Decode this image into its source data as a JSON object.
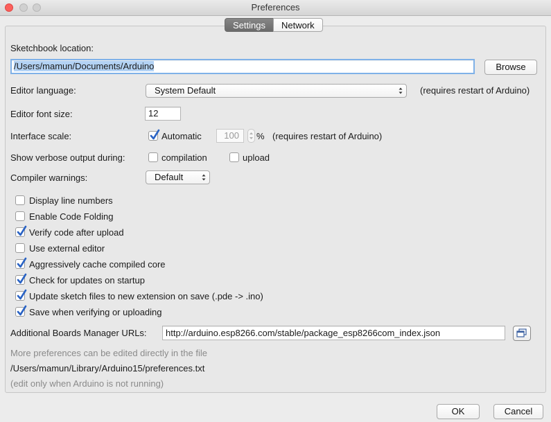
{
  "window": {
    "title": "Preferences"
  },
  "tabs": [
    {
      "label": "Settings",
      "active": true
    },
    {
      "label": "Network",
      "active": false
    }
  ],
  "sketchbook": {
    "label": "Sketchbook location:",
    "value": "/Users/mamun/Documents/Arduino",
    "browse_label": "Browse"
  },
  "editor_language": {
    "label": "Editor language:",
    "value": "System Default",
    "note": "(requires restart of Arduino)"
  },
  "font_size": {
    "label": "Editor font size:",
    "value": "12"
  },
  "interface_scale": {
    "label": "Interface scale:",
    "automatic_label": "Automatic",
    "automatic_checked": true,
    "value": "100",
    "unit": "%",
    "note": "(requires restart of Arduino)"
  },
  "verbose": {
    "label": "Show verbose output during:",
    "compilation_label": "compilation",
    "compilation_checked": false,
    "upload_label": "upload",
    "upload_checked": false
  },
  "compiler_warnings": {
    "label": "Compiler warnings:",
    "value": "Default"
  },
  "options": [
    {
      "label": "Display line numbers",
      "checked": false
    },
    {
      "label": "Enable Code Folding",
      "checked": false
    },
    {
      "label": "Verify code after upload",
      "checked": true
    },
    {
      "label": "Use external editor",
      "checked": false
    },
    {
      "label": "Aggressively cache compiled core",
      "checked": true
    },
    {
      "label": "Check for updates on startup",
      "checked": true
    },
    {
      "label": "Update sketch files to new extension on save (.pde -> .ino)",
      "checked": true
    },
    {
      "label": "Save when verifying or uploading",
      "checked": true
    }
  ],
  "boards_urls": {
    "label": "Additional Boards Manager URLs:",
    "value": "http://arduino.esp8266.com/stable/package_esp8266com_index.json"
  },
  "footer": {
    "more_prefs": "More preferences can be edited directly in the file",
    "path": "/Users/mamun/Library/Arduino15/preferences.txt",
    "note": "(edit only when Arduino is not running)"
  },
  "buttons": {
    "ok": "OK",
    "cancel": "Cancel"
  },
  "colors": {
    "check_accent": "#2a63c4",
    "selection": "#b3d2f4",
    "focus_ring": "#7fb1e8"
  }
}
